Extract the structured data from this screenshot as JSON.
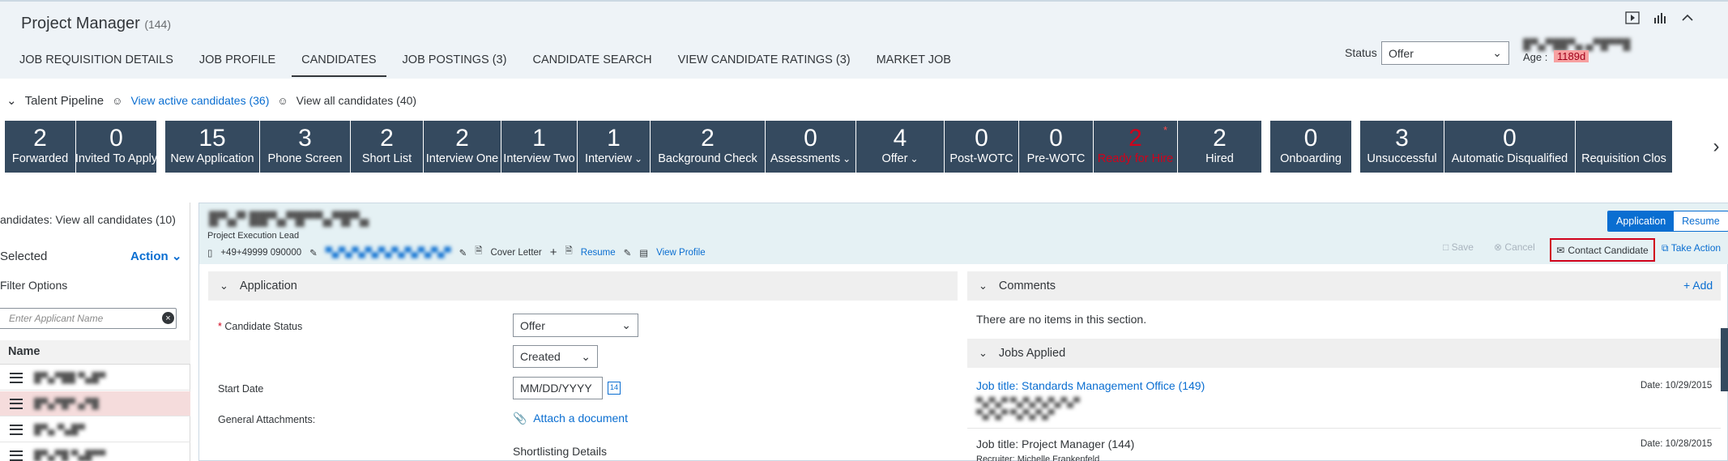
{
  "header": {
    "title": "Project Manager",
    "count": "(144)",
    "tabs": [
      "JOB REQUISITION DETAILS",
      "JOB PROFILE",
      "CANDIDATES",
      "JOB POSTINGS (3)",
      "CANDIDATE SEARCH",
      "VIEW CANDIDATE RATINGS (3)",
      "MARKET JOB"
    ],
    "active_tab": "CANDIDATES",
    "status_label": "Status",
    "status_value": "Offer",
    "age_label": "Age :",
    "age_value": "1189d",
    "tool_icons": [
      "play-icon",
      "chart-icon",
      "collapse-icon"
    ]
  },
  "pipeline": {
    "title": "Talent Pipeline",
    "active_link": "View active candidates (36)",
    "all_link": "View all candidates (40)",
    "tiles": [
      {
        "n": "2",
        "l": "Forwarded"
      },
      {
        "n": "0",
        "l": "Invited To Apply"
      },
      {
        "n": "15",
        "l": "New Application"
      },
      {
        "n": "3",
        "l": "Phone Screen"
      },
      {
        "n": "2",
        "l": "Short List"
      },
      {
        "n": "2",
        "l": "Interview One"
      },
      {
        "n": "1",
        "l": "Interview Two"
      },
      {
        "n": "1",
        "l": "Interview"
      },
      {
        "n": "2",
        "l": "Background Check"
      },
      {
        "n": "0",
        "l": "Assessments"
      },
      {
        "n": "4",
        "l": "Offer"
      },
      {
        "n": "0",
        "l": "Post-WOTC"
      },
      {
        "n": "0",
        "l": "Pre-WOTC"
      },
      {
        "n": "2",
        "l": "Ready for Hire"
      },
      {
        "n": "2",
        "l": "Hired"
      },
      {
        "n": "0",
        "l": "Onboarding"
      },
      {
        "n": "3",
        "l": "Unsuccessful"
      },
      {
        "n": "0",
        "l": "Automatic Disqualified"
      },
      {
        "n": "",
        "l": "Requisition Clos"
      }
    ]
  },
  "left": {
    "title": "andidates: View all candidates (10)",
    "selected": "Selected",
    "action": "Action",
    "filter": "Filter Options",
    "search_placeholder": "Enter Applicant Name",
    "name_header": "Name"
  },
  "candidate": {
    "role": "Project Execution Lead",
    "phone": "+49+49999 090000",
    "cover_letter": "Cover Letter",
    "resume": "Resume",
    "view_profile": "View Profile",
    "seg_application": "Application",
    "seg_resume": "Resume",
    "save": "Save",
    "cancel": "Cancel",
    "contact": "Contact Candidate",
    "take_action": "Take Action"
  },
  "application": {
    "section": "Application",
    "status_label": "Candidate Status",
    "status_value": "Offer",
    "substatus_value": "Created",
    "start_label": "Start Date",
    "start_placeholder": "MM/DD/YYYY",
    "attach_label": "General Attachments:",
    "attach_link": "Attach a document",
    "shortlisting": "Shortlisting Details"
  },
  "comments": {
    "section": "Comments",
    "add": "+ Add",
    "empty": "There are no items in this section."
  },
  "jobs": {
    "section": "Jobs Applied",
    "items": [
      {
        "title": "Job title: Standards Management Office (149)",
        "date": "Date: 10/29/2015"
      },
      {
        "title": "Job title: Project Manager (144)",
        "date": "Date: 10/28/2015",
        "recruiter": "Recruiter: Michelle Frankenfeld"
      }
    ]
  }
}
